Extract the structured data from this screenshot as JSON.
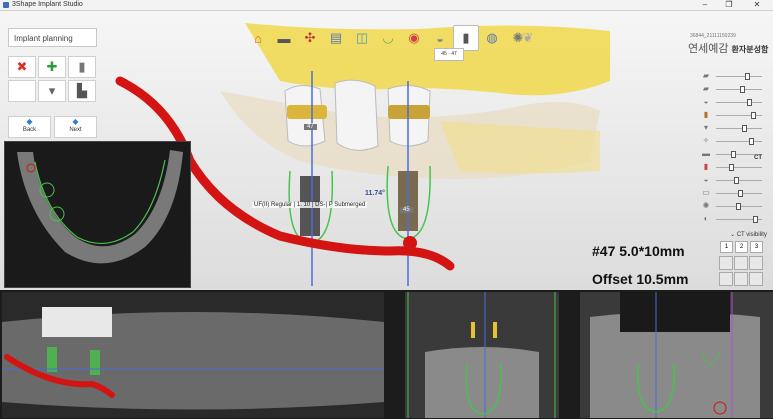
{
  "window": {
    "title": "3Shape Implant Studio"
  },
  "planning_panel": {
    "header": "Implant planning",
    "back_label": "Back",
    "next_label": "Next",
    "tools": [
      {
        "icon": "delete-x-icon",
        "glyph": "✖",
        "color": "#d9342b"
      },
      {
        "icon": "add-plus-icon",
        "glyph": "✚",
        "color": "#2e9b35"
      },
      {
        "icon": "implant-icon",
        "glyph": "▮",
        "color": "#777777"
      },
      {
        "icon": "empty-slot",
        "glyph": "",
        "color": "#777777"
      },
      {
        "icon": "abutment-icon",
        "glyph": "▾",
        "color": "#666666"
      },
      {
        "icon": "sleeve-icon",
        "glyph": "▙",
        "color": "#555555"
      }
    ]
  },
  "toolbar": {
    "items": [
      {
        "icon": "home-icon",
        "glyph": "⌂"
      },
      {
        "icon": "panoramic-icon",
        "glyph": "▬"
      },
      {
        "icon": "nerve-icon",
        "glyph": "✣"
      },
      {
        "icon": "scan-icon",
        "glyph": "▤"
      },
      {
        "icon": "jaw-icon",
        "glyph": "◫"
      },
      {
        "icon": "arch-icon",
        "glyph": "◡"
      },
      {
        "icon": "tooth-view-icon",
        "glyph": "◉"
      },
      {
        "icon": "crown-icon",
        "glyph": "◒"
      },
      {
        "icon": "implant-tool-icon",
        "glyph": "▮"
      },
      {
        "icon": "sleeve-tool-icon",
        "glyph": "◍"
      },
      {
        "icon": "guide-icon",
        "glyph": "✺"
      },
      {
        "icon": "tooth-export-icon",
        "glyph": "❦"
      }
    ],
    "active_caption": "45 · 47"
  },
  "patient": {
    "id": "36844_21111150239",
    "name": "연세예감",
    "subtitle": "환자분성함"
  },
  "viewport": {
    "implant_label": "UF(II) Regular | 1. 10 | DS-| P Submerged",
    "angle": "11.74°",
    "tooth_left": "47",
    "tooth_right": "45",
    "measurement_1": "#47 5.0*10mm",
    "measurement_2": "Offset 10.5mm",
    "ct_label": "CT",
    "ct_visibility": "CT visibility",
    "view_buttons": [
      "1",
      "2",
      "3"
    ]
  },
  "sliders": [
    {
      "icon": "tooth-icon",
      "value": 0.65
    },
    {
      "icon": "jaw-icon",
      "value": 0.55
    },
    {
      "icon": "gum-icon",
      "value": 0.7
    },
    {
      "icon": "crown-icon",
      "value": 0.8
    },
    {
      "icon": "abutment-icon",
      "value": 0.6
    },
    {
      "icon": "tool-icon",
      "value": 0.75
    },
    {
      "icon": "ct-icon",
      "value": 0.35
    },
    {
      "icon": "tooth-red-icon",
      "value": 0.3
    },
    {
      "icon": "shell-icon",
      "value": 0.4
    },
    {
      "icon": "scan-icon",
      "value": 0.5
    },
    {
      "icon": "brightness-icon",
      "value": 0.45
    },
    {
      "icon": "contrast-icon",
      "value": 0.85
    }
  ],
  "colors": {
    "accent": "#2f7fd6",
    "nerve": "#d41313",
    "implant_outline": "#47c24b",
    "crown": "#e9c233"
  }
}
